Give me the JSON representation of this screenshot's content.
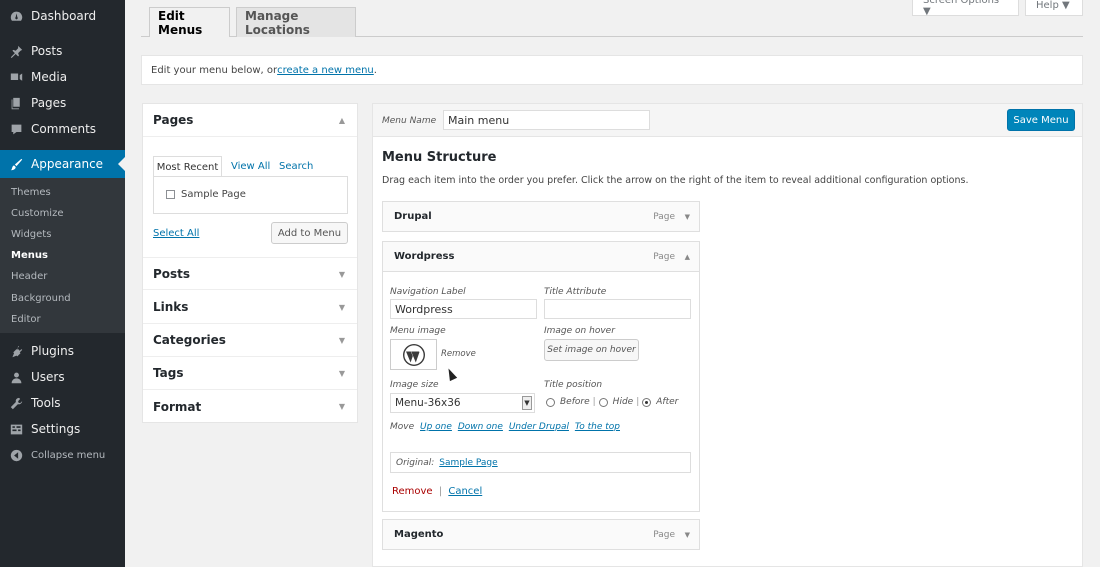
{
  "sidebar": {
    "items": [
      {
        "label": "Dashboard",
        "icon": "dashboard-icon"
      },
      {
        "label": "Posts",
        "icon": "pin-icon"
      },
      {
        "label": "Media",
        "icon": "media-icon"
      },
      {
        "label": "Pages",
        "icon": "pages-icon"
      },
      {
        "label": "Comments",
        "icon": "comments-icon"
      },
      {
        "label": "Appearance",
        "icon": "brush-icon"
      },
      {
        "label": "Plugins",
        "icon": "plugin-icon"
      },
      {
        "label": "Users",
        "icon": "users-icon"
      },
      {
        "label": "Tools",
        "icon": "wrench-icon"
      },
      {
        "label": "Settings",
        "icon": "settings-icon"
      }
    ],
    "submenu": [
      "Themes",
      "Customize",
      "Widgets",
      "Menus",
      "Header",
      "Background",
      "Editor"
    ],
    "collapse": "Collapse menu"
  },
  "top": {
    "screen_options": "Screen Options ▼",
    "help": "Help ▼"
  },
  "tabs": {
    "edit": "Edit Menus",
    "manage": "Manage Locations"
  },
  "notice": {
    "text": "Edit your menu below, or ",
    "link": "create a new menu",
    "end": "."
  },
  "left": {
    "pages_title": "Pages",
    "tabs": [
      "Most Recent",
      "View All",
      "Search"
    ],
    "item": "Sample Page",
    "select_all": "Select All",
    "add_button": "Add to Menu",
    "sections": [
      "Posts",
      "Links",
      "Categories",
      "Tags",
      "Format"
    ]
  },
  "main": {
    "menu_name_label": "Menu Name",
    "menu_name": "Main menu",
    "save": "Save Menu",
    "structure_title": "Menu Structure",
    "structure_desc": "Drag each item into the order you prefer. Click the arrow on the right of the item to reveal additional configuration options.",
    "items": [
      {
        "title": "Drupal",
        "type": "Page"
      },
      {
        "title": "Wordpress",
        "type": "Page"
      },
      {
        "title": "Magento",
        "type": "Page"
      }
    ],
    "settings": {
      "nav_label": "Navigation Label",
      "nav_value": "Wordpress",
      "title_attr": "Title Attribute",
      "title_attr_value": "",
      "menu_image": "Menu image",
      "remove_image": "Remove",
      "image_hover": "Image on hover",
      "set_hover": "Set image on hover",
      "image_size": "Image size",
      "image_size_value": "Menu-36x36",
      "title_position": "Title position",
      "positions": [
        "Before",
        "Hide",
        "After"
      ],
      "move": "Move",
      "move_links": [
        "Up one",
        "Down one",
        "Under Drupal",
        "To the top"
      ],
      "original_label": "Original:",
      "original_link": "Sample Page",
      "remove": "Remove",
      "cancel": "Cancel"
    }
  }
}
